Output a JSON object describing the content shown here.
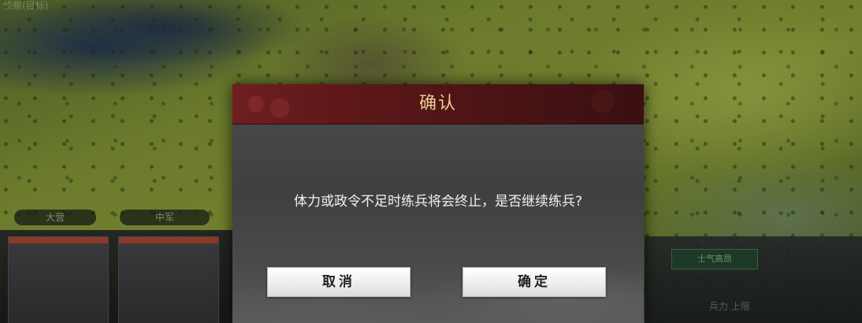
{
  "map": {
    "top_left_label": "侦察(目标)"
  },
  "hud": {
    "tabs": [
      "大营",
      "中军"
    ],
    "status_badge": "士气高昂",
    "right_text": "兵力 上限"
  },
  "dialog": {
    "title": "确认",
    "message": "体力或政令不足时练兵将会终止，是否继续练兵?",
    "cancel_label": "取消",
    "confirm_label": "确定"
  },
  "colors": {
    "header_red": "#6e1e1f",
    "title_gold": "#e9cf96",
    "dialog_bg": "#454546",
    "button_bg": "#f2f2f2"
  }
}
